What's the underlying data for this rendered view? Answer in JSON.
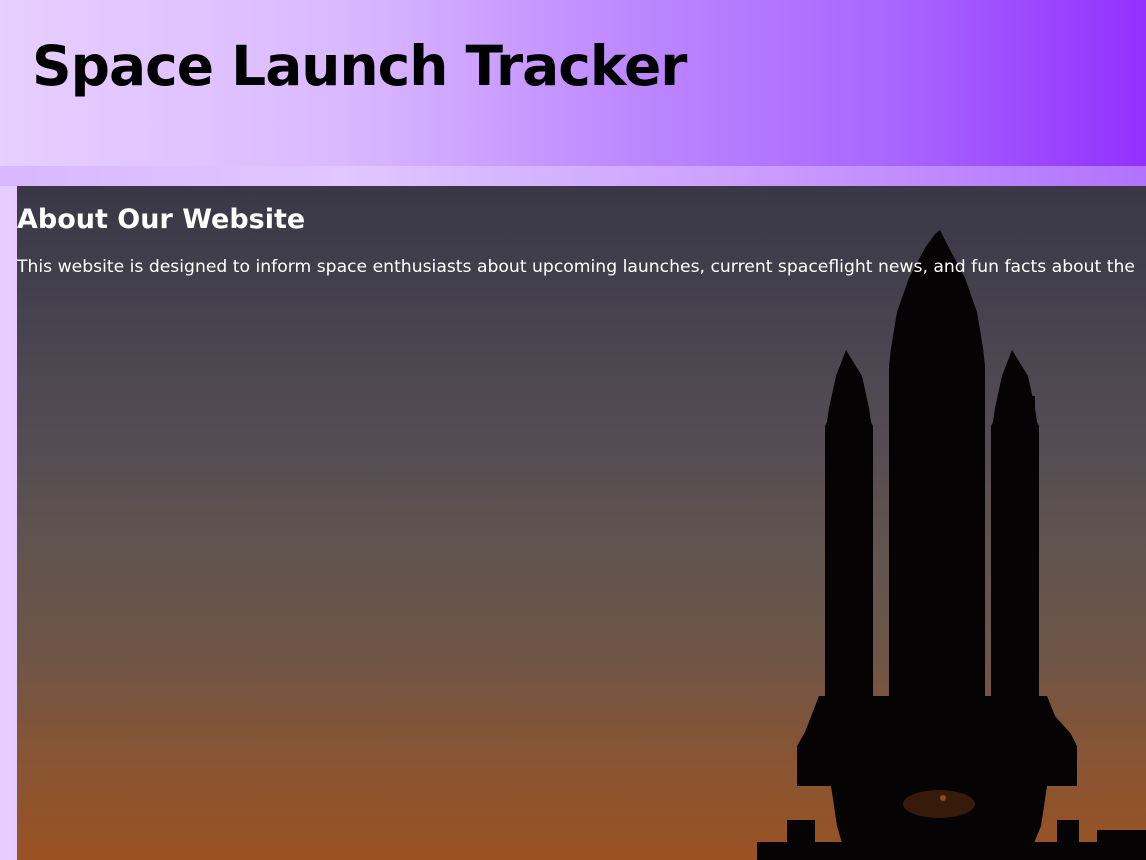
{
  "header": {
    "title": "Space Launch Tracker"
  },
  "about": {
    "heading": "About Our Website",
    "text": "This website is designed to inform space enthusiasts about upcoming launches, current spaceflight news, and fun facts about the"
  },
  "colors": {
    "header_gradient_start": "#e7cfff",
    "header_gradient_end": "#9330ff",
    "sky_top": "#3a3746",
    "sky_bottom": "#9a5223",
    "text_on_image": "#ffffff",
    "title_text": "#000000"
  },
  "icons": {
    "hero_image": "space-shuttle-silhouette"
  }
}
